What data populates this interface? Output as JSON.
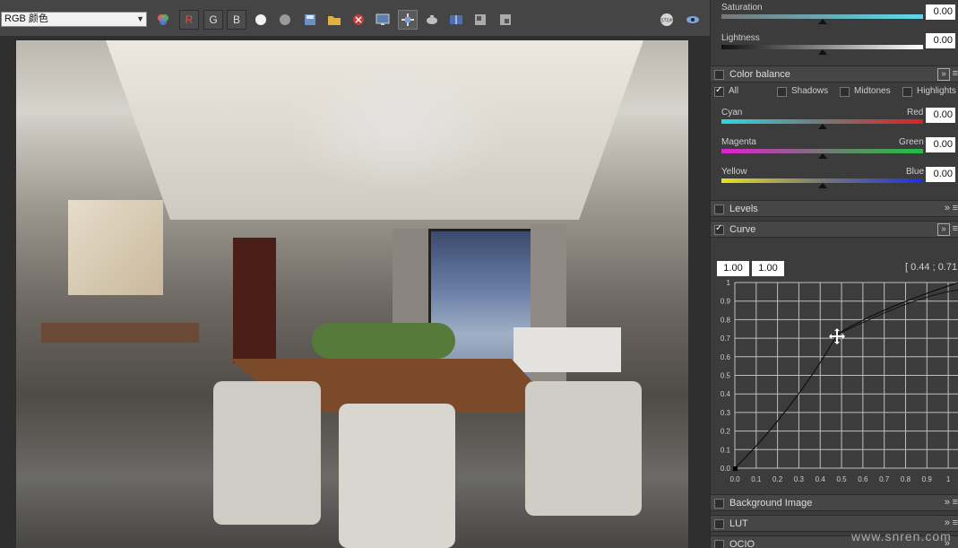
{
  "toolbar": {
    "channel_select_value": "RGB 颜色",
    "r_label": "R",
    "g_label": "G",
    "b_label": "B"
  },
  "panel": {
    "saturation": {
      "label": "Saturation",
      "value": "0.00"
    },
    "lightness": {
      "label": "Lightness",
      "value": "0.00"
    },
    "color_balance": {
      "title": "Color balance",
      "all": "All",
      "shadows": "Shadows",
      "midtones": "Midtones",
      "highlights": "Highlights",
      "cyan": "Cyan",
      "red": "Red",
      "cyan_red_value": "0.00",
      "magenta": "Magenta",
      "green": "Green",
      "magenta_green_value": "0.00",
      "yellow": "Yellow",
      "blue": "Blue",
      "yellow_blue_value": "0.00"
    },
    "levels": {
      "title": "Levels"
    },
    "curve": {
      "title": "Curve",
      "input_x": "1.00",
      "input_y": "1.00",
      "coords": "[ 0.44 ; 0.71",
      "y_ticks": [
        "1",
        "0.9",
        "0.8",
        "0.7",
        "0.6",
        "0.5",
        "0.4",
        "0.3",
        "0.2",
        "0.1",
        "0.0"
      ],
      "x_ticks": [
        "0.0",
        "0.1",
        "0.2",
        "0.3",
        "0.4",
        "0.5",
        "0.6",
        "0.7",
        "0.8",
        "0.9",
        "1"
      ]
    },
    "background_image": {
      "title": "Background Image"
    },
    "lut": {
      "title": "LUT"
    },
    "ocio": {
      "title": "OCIO"
    }
  },
  "watermark": "www.snren.com",
  "colors": {
    "panel_bg": "#3c3c3c",
    "toolbar_bg": "#454545",
    "grid_line": "#bfbfbf",
    "curve_line": "#111111"
  }
}
